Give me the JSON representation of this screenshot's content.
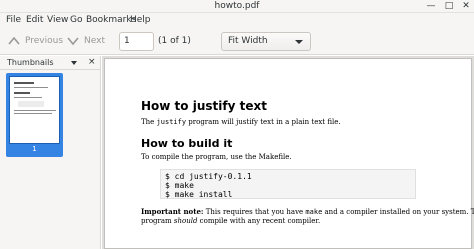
{
  "window": {
    "title": "howto.pdf",
    "minimize_glyph": "—",
    "maximize_glyph": "□",
    "close_glyph": "✕"
  },
  "menu": [
    "File",
    "Edit",
    "View",
    "Go",
    "Bookmarks",
    "Help"
  ],
  "toolbar": {
    "previous_label": "Previous",
    "next_label": "Next",
    "page_value": "1",
    "page_count": "(1 of 1)",
    "zoom_value": "Fit Width"
  },
  "sidebar": {
    "header": "Thumbnails",
    "close_glyph": "×",
    "thumbnail_page_number": "1"
  },
  "document": {
    "heading1": "How to justify text",
    "p1_pre": "The ",
    "p1_code": "justify",
    "p1_post": " program will justify text in a plain text file.",
    "heading2": "How to build it",
    "p2": "To compile the program, use the Makefile.",
    "code_lines": [
      "$ cd justify-0.1.1",
      "$ make",
      "$ make install"
    ],
    "note_bold": "Important note:",
    "note_pre": " This requires that you have ",
    "note_code": "make",
    "note_post": " and a compiler installed on your system. The",
    "note2_pre": "program ",
    "note2_em": "should",
    "note2_post": " compile with any recent compiler."
  },
  "colors": {
    "accent": "#3584e4",
    "toolbar_bg": "#f6f5f4",
    "viewport_bg": "#deddda"
  }
}
